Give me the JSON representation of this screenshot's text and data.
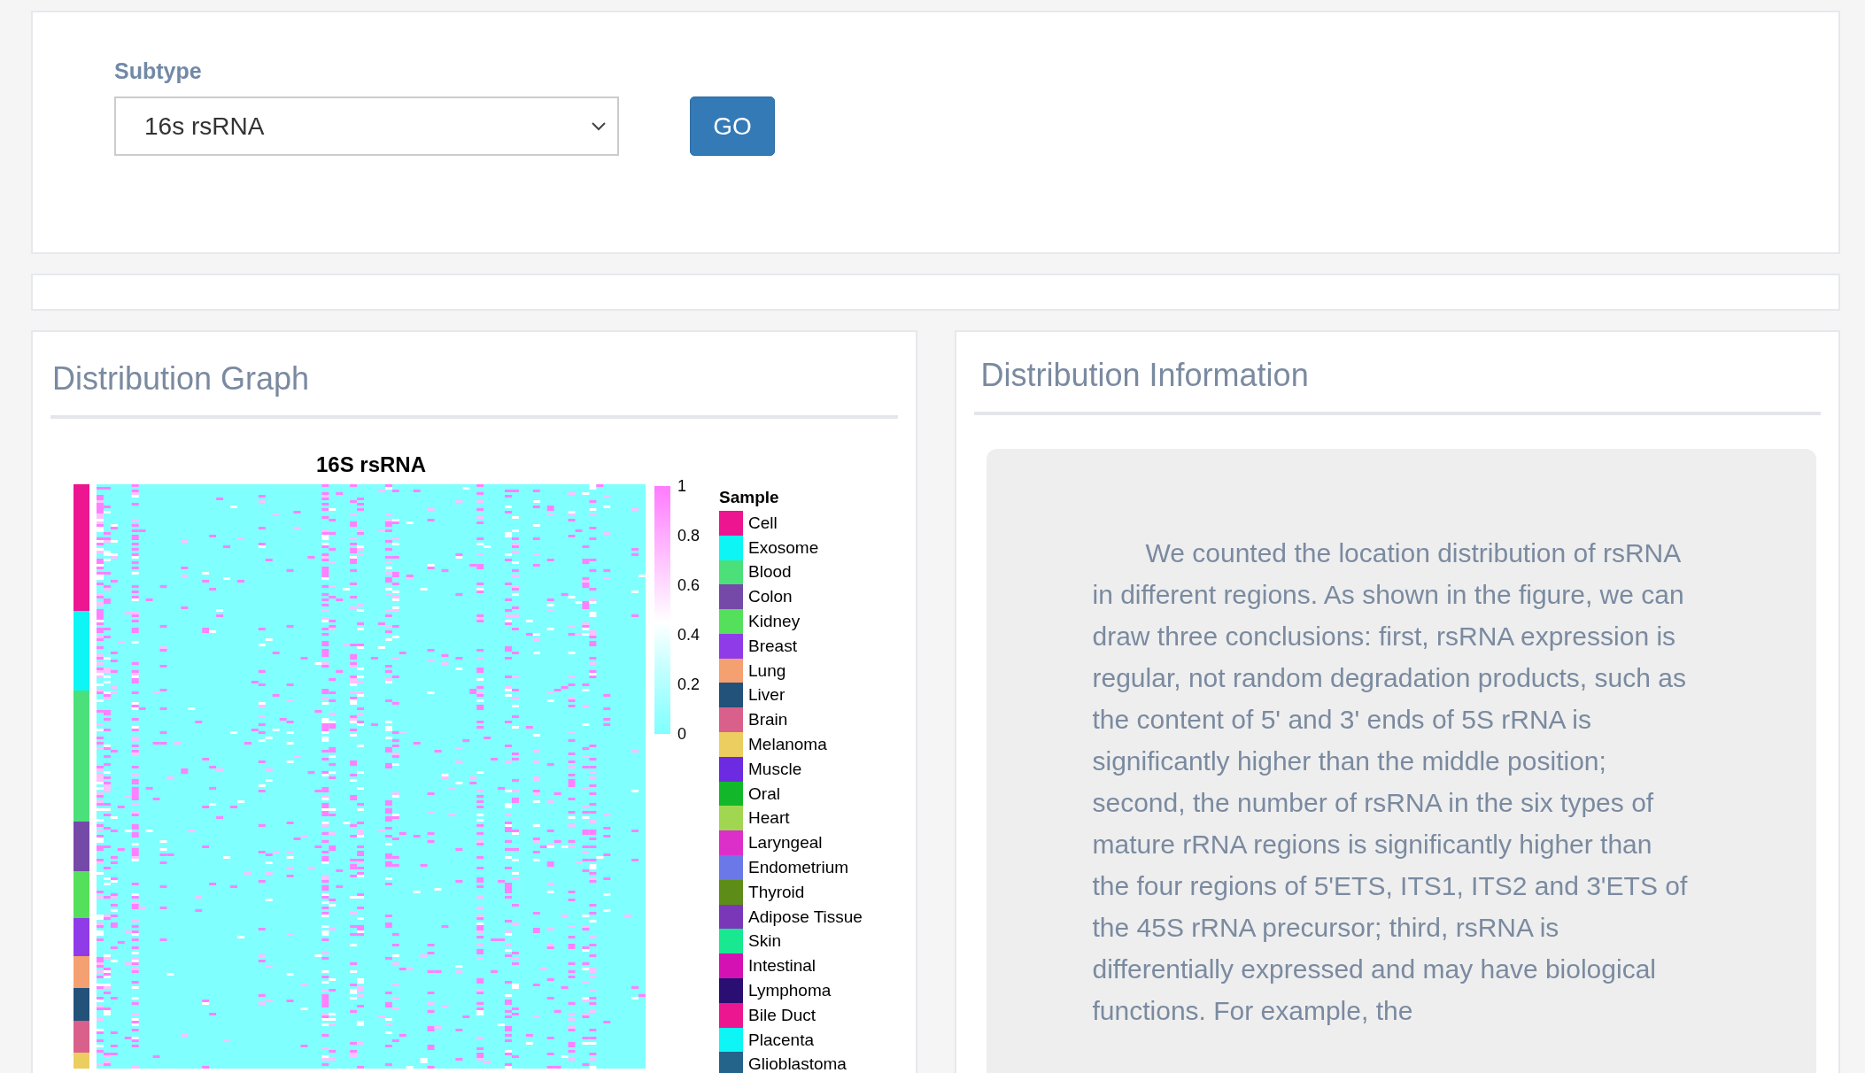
{
  "filter": {
    "label": "Subtype",
    "select": {
      "value": "16s rsRNA"
    },
    "button": "GO"
  },
  "graph_panel": {
    "title": "Distribution Graph",
    "heatmap": {
      "title": "16S rsRNA",
      "colorbar": {
        "ticks": [
          "1",
          "0.8",
          "0.6",
          "0.4",
          "0.2",
          "0"
        ]
      },
      "legend": {
        "title": "Sample",
        "items": [
          {
            "label": "Cell",
            "color": "#ed1590"
          },
          {
            "label": "Exosome",
            "color": "#0ef5f5"
          },
          {
            "label": "Blood",
            "color": "#4be07a"
          },
          {
            "label": "Colon",
            "color": "#7549a8"
          },
          {
            "label": "Kidney",
            "color": "#54e05a"
          },
          {
            "label": "Breast",
            "color": "#8f3be8"
          },
          {
            "label": "Lung",
            "color": "#f4a070"
          },
          {
            "label": "Liver",
            "color": "#22517a"
          },
          {
            "label": "Brain",
            "color": "#d9608a"
          },
          {
            "label": "Melanoma",
            "color": "#ecce60"
          },
          {
            "label": "Muscle",
            "color": "#6c2be0"
          },
          {
            "label": "Oral",
            "color": "#13b82a"
          },
          {
            "label": "Heart",
            "color": "#a0d650"
          },
          {
            "label": "Laryngeal",
            "color": "#dc2ec8"
          },
          {
            "label": "Endometrium",
            "color": "#6a78e8"
          },
          {
            "label": "Thyroid",
            "color": "#5e8c18"
          },
          {
            "label": "Adipose Tissue",
            "color": "#7a38b8"
          },
          {
            "label": "Skin",
            "color": "#18e890"
          },
          {
            "label": "Intestinal",
            "color": "#d412b4"
          },
          {
            "label": "Lymphoma",
            "color": "#2a0e72"
          },
          {
            "label": "Bile Duct",
            "color": "#ec1690"
          },
          {
            "label": "Placenta",
            "color": "#0ef5f5"
          },
          {
            "label": "Glioblastoma",
            "color": "#24648a"
          }
        ]
      }
    }
  },
  "info_panel": {
    "title": "Distribution Information",
    "text": "We counted the location distribution of rsRNA in different regions. As shown in the figure, we can draw three conclusions: first, rsRNA expression is regular, not random degradation products, such as the content of 5' and 3' ends of 5S rRNA is significantly higher than the middle position; second, the number of rsRNA in the six types of mature rRNA regions is significantly higher than the four regions of 5'ETS, ITS1, ITS2 and 3'ETS of the 45S rRNA precursor; third, rsRNA is differentially expressed and may have biological functions. For example, the"
  }
}
